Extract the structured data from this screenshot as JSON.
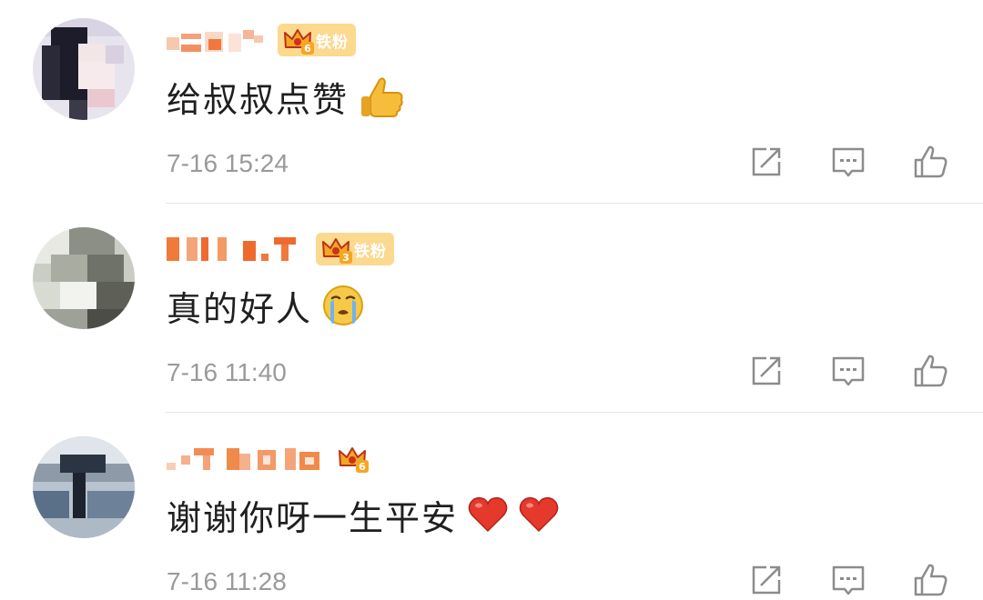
{
  "comments": [
    {
      "badge": {
        "level": "6",
        "label": "铁粉"
      },
      "text": "给叔叔点赞",
      "emoji": "thumbs-up-emoji",
      "timestamp": "7-16 15:24"
    },
    {
      "badge": {
        "level": "3",
        "label": "铁粉"
      },
      "text": "真的好人",
      "emoji": "crying-face-emoji",
      "timestamp": "7-16 11:40"
    },
    {
      "badge": {
        "level": "6",
        "label": ""
      },
      "text": "谢谢你呀一生平安",
      "emoji": "red-heart-emoji",
      "timestamp": "7-16 11:28"
    }
  ],
  "actions": [
    "share-icon",
    "reply-icon",
    "like-icon"
  ],
  "colors": {
    "accent_orange": "#f08a4b",
    "badge_gold": "#fbd98f",
    "crown_orange": "#f5a623",
    "timestamp_gray": "#9a9a9a",
    "icon_gray": "#8c8c8c"
  }
}
